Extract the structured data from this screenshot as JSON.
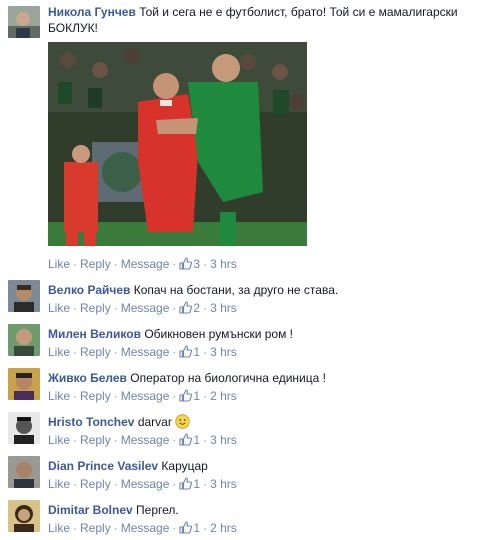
{
  "comments": [
    {
      "author": "Никола Гунчев",
      "text": "Той и сега не е футболист, брато! Той си е мамалигарски БОКЛУК!",
      "like_label": "Like",
      "reply_label": "Reply",
      "message_label": "Message",
      "likes": "3",
      "time": "3 hrs"
    },
    {
      "author": "Велко Райчев",
      "text": "Копач на бостани, за друго не става.",
      "like_label": "Like",
      "reply_label": "Reply",
      "message_label": "Message",
      "likes": "2",
      "time": "3 hrs"
    },
    {
      "author": "Милен Великов",
      "text": "Обикновен румънски ром !",
      "like_label": "Like",
      "reply_label": "Reply",
      "message_label": "Message",
      "likes": "1",
      "time": "3 hrs"
    },
    {
      "author": "Живко Белев",
      "text": "Оператор на биологична единица !",
      "like_label": "Like",
      "reply_label": "Reply",
      "message_label": "Message",
      "likes": "1",
      "time": "2 hrs"
    },
    {
      "author": "Hristo Tonchev",
      "text": "darvar",
      "emoji": "smiley-icon",
      "like_label": "Like",
      "reply_label": "Reply",
      "message_label": "Message",
      "likes": "1",
      "time": "3 hrs"
    },
    {
      "author": "Dian Prince Vasilev",
      "text": "Каруцар",
      "like_label": "Like",
      "reply_label": "Reply",
      "message_label": "Message",
      "likes": "1",
      "time": "3 hrs"
    },
    {
      "author": "Dimitar Bolnev",
      "text": "Пергел.",
      "like_label": "Like",
      "reply_label": "Reply",
      "message_label": "Message",
      "likes": "1",
      "time": "2 hrs"
    }
  ],
  "separator": "·",
  "colors": {
    "author": "#3b5998",
    "link": "#6d84b4",
    "meta": "#9197a3",
    "text": "#141823"
  },
  "icons": {
    "like": "thumbs-up-icon"
  }
}
